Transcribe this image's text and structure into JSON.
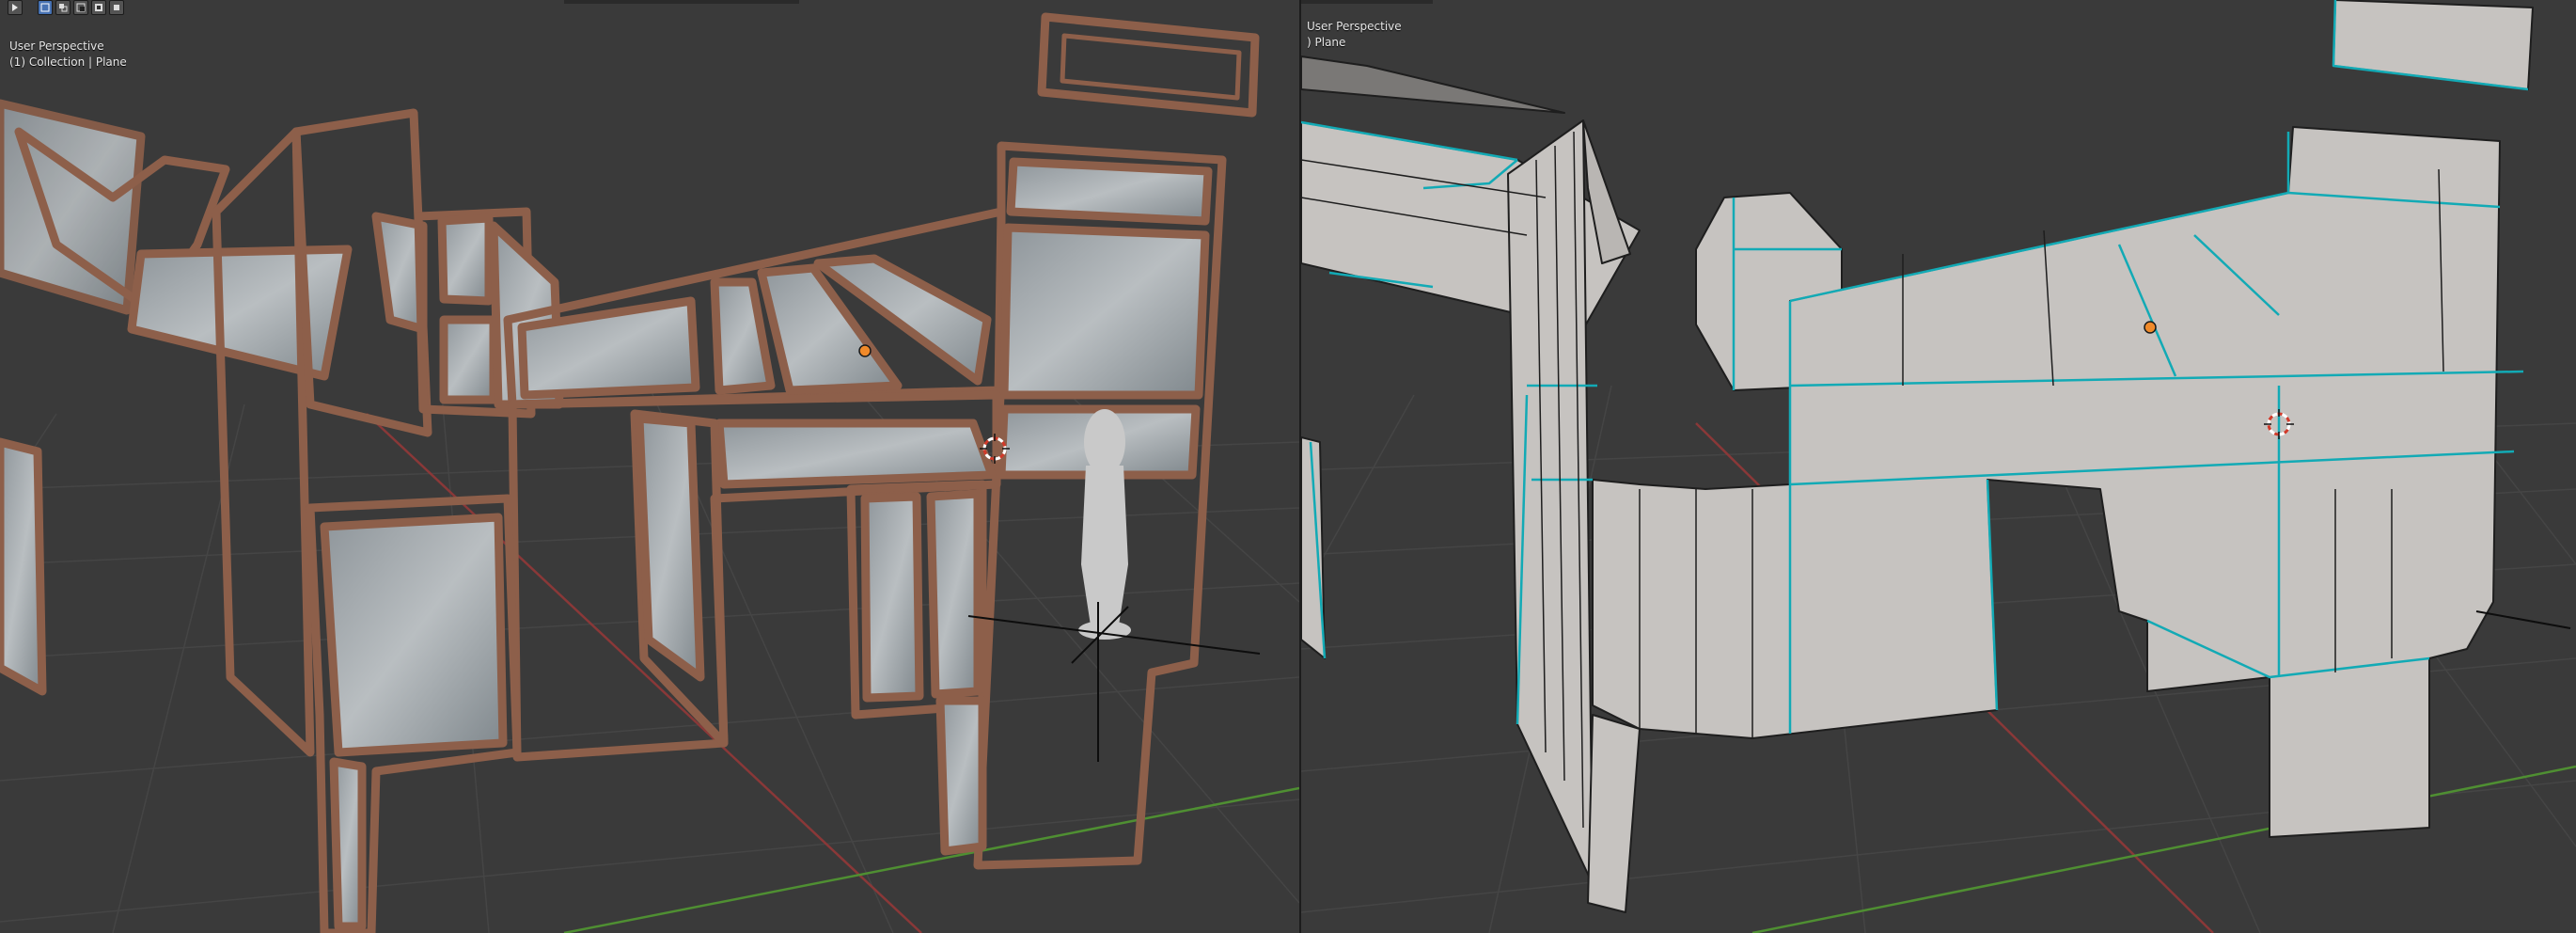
{
  "left_viewport": {
    "view_name": "User Perspective",
    "collection_label": "(1) Collection | Plane"
  },
  "right_viewport": {
    "view_name": "User Perspective",
    "collection_label": ") Plane"
  },
  "toolbar_icons": [
    "select-tool-icon",
    "select-box-icon",
    "select-extend-icon",
    "select-subtract-icon",
    "select-invert-icon",
    "select-intersect-icon"
  ],
  "colors": {
    "viewport_bg": "#3a3a3a",
    "grid": "#444444",
    "x_axis": "#8a3838",
    "y_axis": "#4f8f32",
    "frame_wood": "#8d5f4a",
    "glass": "#a9b0b4",
    "mesh_face": "#c6c3c0",
    "seam": "#12aab5",
    "edge": "#1e1e1e",
    "origin": "#f08a2a"
  }
}
